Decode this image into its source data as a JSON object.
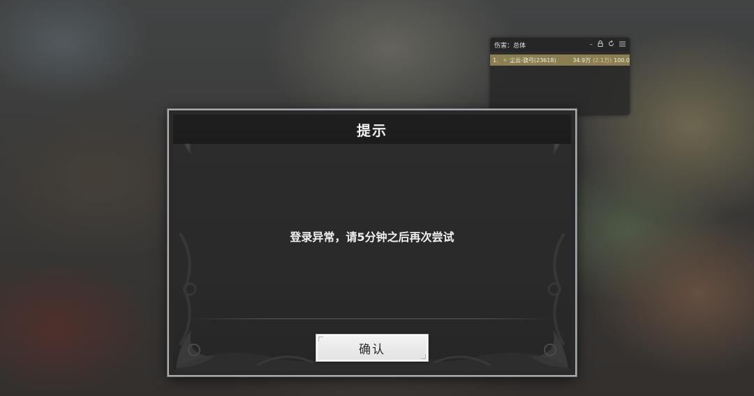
{
  "meter": {
    "title": "伤害：总体",
    "controls": {
      "minimize_icon": "minimize-icon",
      "lock_icon": "lock-icon",
      "reset_icon": "reset-icon",
      "menu_icon": "menu-icon"
    },
    "rows": [
      {
        "rank": "1.",
        "icon": "class-icon",
        "name": "尘云-骁弓(23618)",
        "damage": "34.9万",
        "dps": "(2.1万)",
        "percent": "100.0"
      }
    ],
    "colors": {
      "row_bar": "#8a7e52"
    }
  },
  "dialog": {
    "title": "提示",
    "message": "登录异常，请5分钟之后再次尝试",
    "confirm_label": "确认"
  }
}
